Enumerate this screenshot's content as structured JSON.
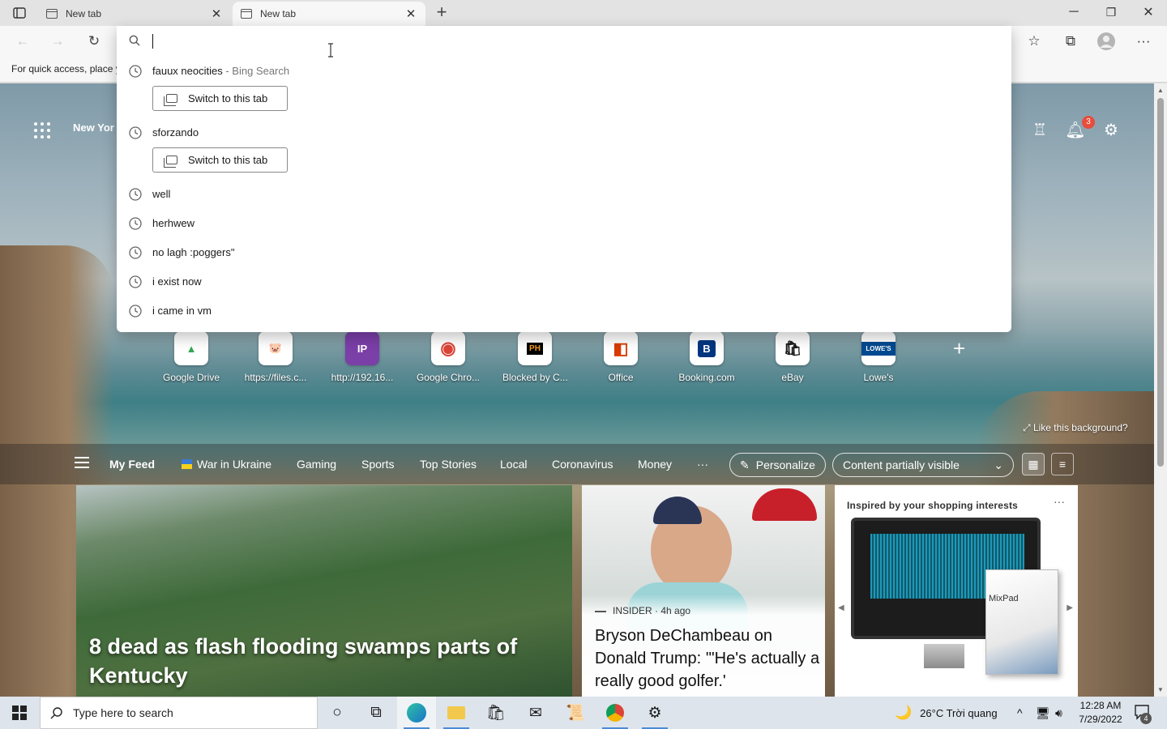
{
  "browser": {
    "tabs": [
      {
        "title": "New tab"
      },
      {
        "title": "New tab"
      }
    ],
    "favorites_bar_hint": "For quick access, place y"
  },
  "omnibox": {
    "input_value": "",
    "suggestions": [
      {
        "text": "fauux neocities",
        "subtext": " - Bing Search",
        "has_switch": true
      },
      {
        "text": "sforzando",
        "subtext": "",
        "has_switch": true
      },
      {
        "text": "well",
        "subtext": "",
        "has_switch": false
      },
      {
        "text": "herhwew",
        "subtext": "",
        "has_switch": false
      },
      {
        "text": "no lagh :poggers\"",
        "subtext": "",
        "has_switch": false
      },
      {
        "text": "i exist now",
        "subtext": "",
        "has_switch": false
      },
      {
        "text": "i came in vm",
        "subtext": "",
        "has_switch": false
      }
    ],
    "switch_label": "Switch to this tab"
  },
  "ntp": {
    "location": "New Yor",
    "notification_count": "3",
    "quick_links": [
      {
        "label": "Google Drive",
        "tile": "▲",
        "color": "#34a853"
      },
      {
        "label": "https://files.c...",
        "tile": "🐷",
        "color": "#e58fb0"
      },
      {
        "label": "http://192.16...",
        "tile": "IP",
        "color": "#7b3fa8"
      },
      {
        "label": "Google Chro...",
        "tile": "◉",
        "color": "#db4437"
      },
      {
        "label": "Blocked by C...",
        "tile": "PH",
        "color": "#f29b1d"
      },
      {
        "label": "Office",
        "tile": "O",
        "color": "#d83b01"
      },
      {
        "label": "Booking.com",
        "tile": "B",
        "color": "#003580"
      },
      {
        "label": "eBay",
        "tile": "🛍",
        "color": "#e53238"
      },
      {
        "label": "Lowe's",
        "tile": "L",
        "color": "#004990"
      }
    ],
    "like_background": "Like this background?",
    "feed_nav": {
      "items": [
        "My Feed",
        "War in Ukraine",
        "Gaming",
        "Sports",
        "Top Stories",
        "Local",
        "Coronavirus",
        "Money"
      ],
      "more": "···",
      "personalize": "Personalize",
      "content_visibility": "Content partially visible"
    },
    "cards": {
      "main_headline": "8 dead as flash flooding swamps parts of Kentucky",
      "mid_source": "INSIDER · 4h ago",
      "mid_title": "Bryson DeChambeau on Donald Trump: '\"He's actually a really good golfer.'",
      "ad_heading": "Inspired by your shopping interests",
      "ad_more": "···",
      "ad_brand": "MixPad"
    }
  },
  "taskbar": {
    "search_placeholder": "Type here to search",
    "weather": "26°C  Trời quang",
    "time": "12:28 AM",
    "date": "7/29/2022",
    "action_center_count": "4"
  }
}
